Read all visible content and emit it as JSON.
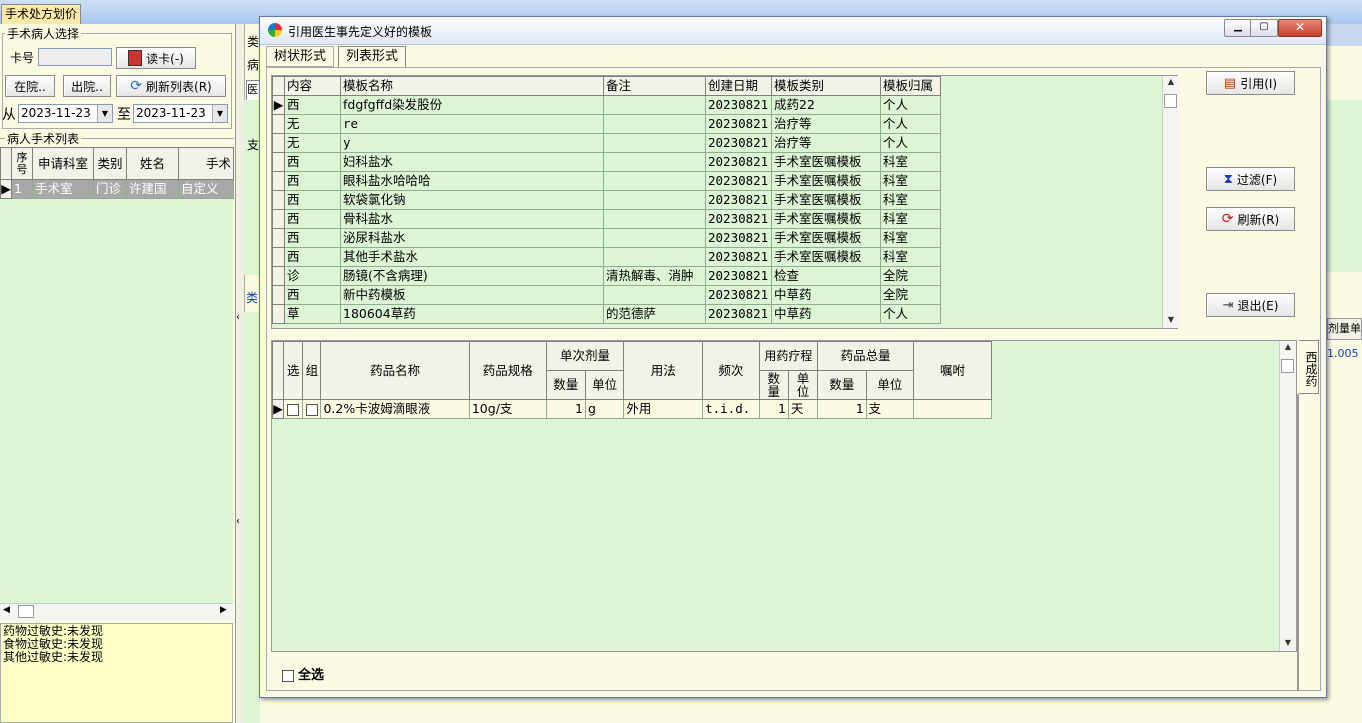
{
  "main_window": {
    "tab_title": "手术处方划价",
    "patient_group": "手术病人选择",
    "card_label": "卡号",
    "card_value": "",
    "read_card_button": "读卡(-)",
    "in_hospital_button": "在院..",
    "discharged_button": "出院..",
    "refresh_list_button": "刷新列表(R)",
    "from_label": "从",
    "to_label": "至",
    "date_from": "2023-11-23",
    "date_to": "2023-11-23",
    "list_group": "病人手术列表",
    "list_headers": [
      "序号",
      "申请科室",
      "类别",
      "姓名",
      "手术"
    ],
    "list_rows": [
      {
        "index": "1",
        "dept": "手术室",
        "category": "门诊",
        "name": "许建国",
        "surgery": "自定义"
      }
    ],
    "allergy_text": [
      "药物过敏史:未发现",
      "食物过敏史:未发现",
      "其他过敏史:未发现"
    ],
    "bg_fragments": {
      "lei": "类",
      "bing": "病",
      "yi": "医",
      "zhi": "支",
      "lei2": "类",
      "xi": "西",
      "cheng": "成",
      "yao": "药",
      "dose_unit": "剂量单",
      "val": "1.005"
    }
  },
  "dialog": {
    "title": "引用医生事先定义好的模板",
    "tabs": [
      "树状形式",
      "列表形式"
    ],
    "template_headers": [
      "内容",
      "模板名称",
      "备注",
      "创建日期",
      "模板类别",
      "模板归属"
    ],
    "templates": [
      {
        "content": "西",
        "name": "fdgfgffd染发股份",
        "remark": "",
        "date": "20230821",
        "category": "成药22",
        "owner": "个人"
      },
      {
        "content": "无",
        "name": "re",
        "remark": "",
        "date": "20230821",
        "category": "治疗等",
        "owner": "个人"
      },
      {
        "content": "无",
        "name": "y",
        "remark": "",
        "date": "20230821",
        "category": "治疗等",
        "owner": "个人"
      },
      {
        "content": "西",
        "name": "妇科盐水",
        "remark": "",
        "date": "20230821",
        "category": "手术室医嘱模板",
        "owner": "科室"
      },
      {
        "content": "西",
        "name": "眼科盐水哈哈哈",
        "remark": "",
        "date": "20230821",
        "category": "手术室医嘱模板",
        "owner": "科室"
      },
      {
        "content": "西",
        "name": "软袋氯化钠",
        "remark": "",
        "date": "20230821",
        "category": "手术室医嘱模板",
        "owner": "科室"
      },
      {
        "content": "西",
        "name": "骨科盐水",
        "remark": "",
        "date": "20230821",
        "category": "手术室医嘱模板",
        "owner": "科室"
      },
      {
        "content": "西",
        "name": "泌尿科盐水",
        "remark": "",
        "date": "20230821",
        "category": "手术室医嘱模板",
        "owner": "科室"
      },
      {
        "content": "西",
        "name": "其他手术盐水",
        "remark": "",
        "date": "20230821",
        "category": "手术室医嘱模板",
        "owner": "科室"
      },
      {
        "content": "诊",
        "name": "肠镜(不含病理)",
        "remark": "清热解毒、消肿",
        "date": "20230821",
        "category": "检查",
        "owner": "全院"
      },
      {
        "content": "西",
        "name": "新中药模板",
        "remark": "",
        "date": "20230821",
        "category": "中草药",
        "owner": "全院"
      },
      {
        "content": "草",
        "name": "180604草药",
        "remark": "的范德萨",
        "date": "20230821",
        "category": "中草药",
        "owner": "个人"
      }
    ],
    "buttons": {
      "quote": "引用(I)",
      "filter": "过滤(F)",
      "refresh": "刷新(R)",
      "exit": "退出(E)"
    },
    "detail_headers": {
      "select": "选",
      "group": "组",
      "drug_name": "药品名称",
      "spec": "药品规格",
      "single_dose": "单次剂量",
      "qty": "数量",
      "unit": "单位",
      "usage": "用法",
      "freq": "频次",
      "course": "用药疗程",
      "course_qty": "数量",
      "course_unit": "单位",
      "total": "药品总量",
      "total_qty": "数量",
      "total_unit": "单位",
      "advice": "嘱咐"
    },
    "detail_rows": [
      {
        "drug_name": "0.2%卡波姆滴眼液",
        "spec": "10g/支",
        "qty": "1",
        "unit": "g",
        "usage": "外用",
        "freq": "t.i.d.",
        "course_qty": "1",
        "course_unit": "天",
        "total_qty": "1",
        "total_unit": "支",
        "advice": ""
      }
    ],
    "side_tab": "西成药",
    "select_all": "全选"
  }
}
